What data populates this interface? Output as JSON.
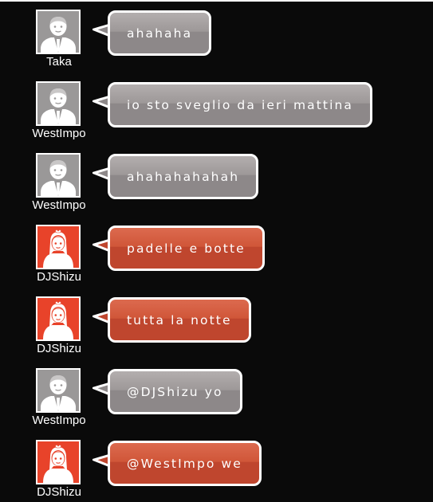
{
  "messages": [
    {
      "user": "Taka",
      "text": "ahahaha",
      "avatar": "man-avatar-icon",
      "tone": "gray"
    },
    {
      "user": "WestImpo",
      "text": "io sto sveglio da ieri mattina",
      "avatar": "man-avatar-icon",
      "tone": "gray"
    },
    {
      "user": "WestImpo",
      "text": "ahahahahahah",
      "avatar": "man-avatar-icon",
      "tone": "gray"
    },
    {
      "user": "DJShizu",
      "text": "padelle e botte",
      "avatar": "woman-avatar-icon",
      "tone": "red"
    },
    {
      "user": "DJShizu",
      "text": "tutta la notte",
      "avatar": "woman-avatar-icon",
      "tone": "red"
    },
    {
      "user": "WestImpo",
      "text": "@DJShizu yo",
      "avatar": "man-avatar-icon",
      "tone": "gray"
    },
    {
      "user": "DJShizu",
      "text": "@WestImpo we",
      "avatar": "woman-avatar-icon",
      "tone": "red"
    }
  ],
  "colors": {
    "background": "#0a0a0a",
    "gray_bubble": "#8d8889",
    "red_bubble": "#bf462e",
    "gray_avatar_bg": "#9a9898",
    "red_avatar_bg": "#e8432a"
  }
}
